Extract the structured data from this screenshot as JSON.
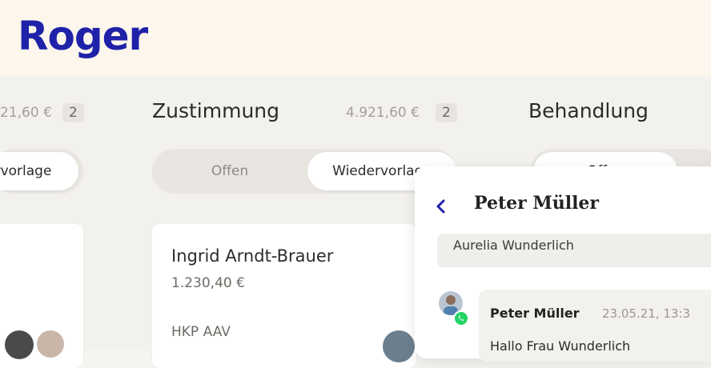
{
  "brand": {
    "logo": "Roger",
    "color": "#1f22a8"
  },
  "columns": [
    {
      "amount": "21,60 €",
      "count": "2",
      "tab_wieder": "rvorlage"
    },
    {
      "title": "Zustimmung",
      "amount": "4.921,60 €",
      "count": "2",
      "tab_offen": "Offen",
      "tab_wieder": "Wiedervorlage"
    },
    {
      "title": "Behandlung",
      "tab_offen": "Offen"
    }
  ],
  "card": {
    "name": "Ingrid Arndt-Brauer",
    "amount": "1.230,40 €",
    "tag": "HKP AAV"
  },
  "chat": {
    "title": "Peter Müller",
    "contact": "Aurelia Wunderlich",
    "message": {
      "sender": "Peter Müller",
      "time": "23.05.21, 13:3",
      "text": "Hallo Frau Wunderlich"
    }
  },
  "icons": {
    "back": "chevron-left-icon",
    "whatsapp": "whatsapp-icon"
  }
}
